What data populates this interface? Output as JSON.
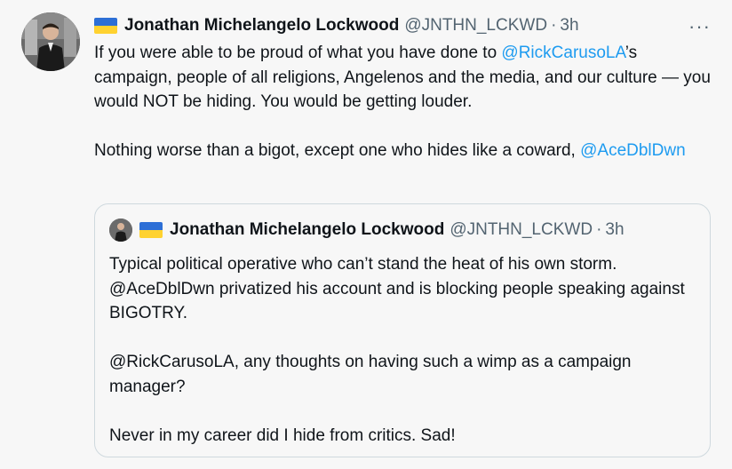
{
  "tweet": {
    "author_name": "Jonathan Michelangelo Lockwood",
    "handle": "@JNTHN_LCKWD",
    "separator": "·",
    "time": "3h",
    "more": "···",
    "text": {
      "p1_a": "If you were able to be proud of what you have done to ",
      "p1_mention": "@RickCarusoLA",
      "p1_b": "’s campaign, people of all religions, Angelenos and the media, and our culture — you would NOT be hiding. You would be getting louder.",
      "p2_a": "Nothing worse than a bigot, except one who hides like a coward, ",
      "p2_mention": "@AceDblDwn"
    }
  },
  "quote": {
    "author_name": "Jonathan Michelangelo Lockwood",
    "handle": "@JNTHN_LCKWD",
    "separator": "·",
    "time": "3h",
    "p1": "Typical political operative who can’t stand the heat of his own storm. @AceDblDwn privatized his account and is blocking people speaking against BIGOTRY.",
    "p2": "@RickCarusoLA, any thoughts on having such a wimp as a campaign manager?",
    "p3": "Never in my career did I hide from critics. Sad!"
  },
  "colors": {
    "background": "#f7f7f7",
    "text": "#0f1419",
    "secondary": "#536471",
    "link": "#1d9bf0",
    "border": "#cfd9de",
    "flag_blue": "#2d6fd6",
    "flag_yellow": "#ffd230"
  },
  "icons": [
    "avatar",
    "ukraine-flag-icon",
    "more-options-icon"
  ]
}
